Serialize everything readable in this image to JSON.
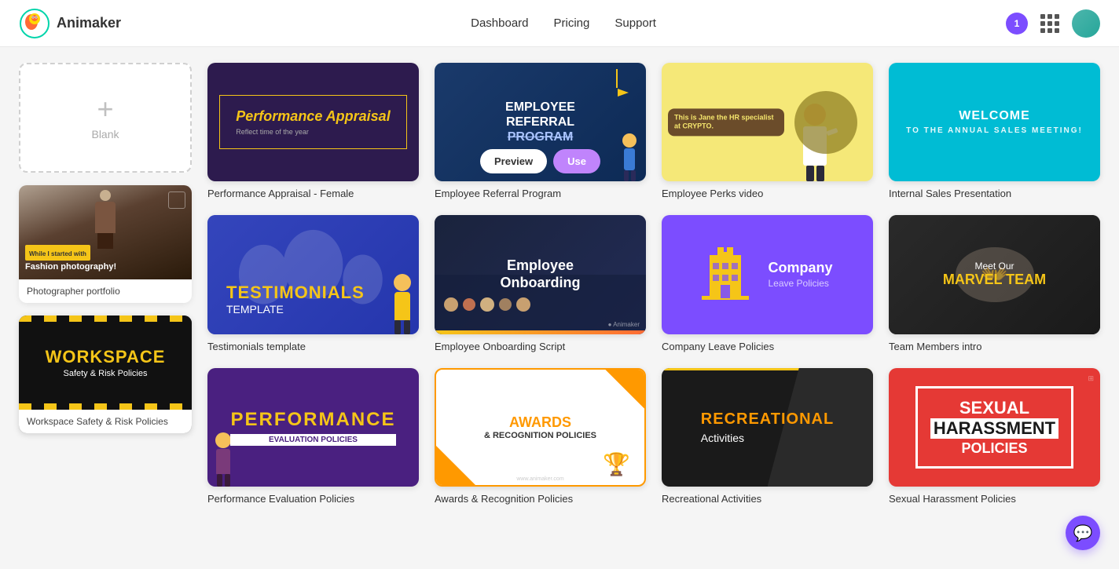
{
  "header": {
    "logo_text": "Animaker",
    "nav": {
      "dashboard": "Dashboard",
      "pricing": "Pricing",
      "support": "Support"
    },
    "notification_count": "1"
  },
  "sidebar": {
    "blank_label": "Blank",
    "items": [
      {
        "id": "photographer-portfolio",
        "label": "Photographer portfolio",
        "thumb_text": "Fashion photography!",
        "thumb_tag": "While I started with"
      },
      {
        "id": "workspace-safety",
        "label": "Workspace Safety & Risk Policies",
        "title": "WORKSPACE",
        "subtitle": "Safety & Risk Policies"
      }
    ]
  },
  "templates": [
    {
      "id": "perf-appraisal",
      "name": "Performance Appraisal - Female",
      "bg": "#2d1b4e",
      "type": "perf-appraisal"
    },
    {
      "id": "employee-referral",
      "name": "Employee Referral Program",
      "bg": "#1a3a6b",
      "type": "employee-referral",
      "lines": [
        "EMPLOYEE",
        "REFERRAL",
        "PROGRAM"
      ]
    },
    {
      "id": "employee-perks",
      "name": "Employee Perks video",
      "bg": "#f5e66d",
      "type": "employee-perks",
      "caption": "This is Jane the HR specialist at CRYPTO."
    },
    {
      "id": "internal-sales",
      "name": "Internal Sales Presentation",
      "bg": "#00bcd4",
      "type": "internal-sales",
      "title": "WELCOME",
      "subtitle": "TO THE ANNUAL SALES MEETING!"
    },
    {
      "id": "testimonials",
      "name": "Testimonials template",
      "bg": "#3d4fc4",
      "type": "testimonials",
      "title": "TESTIMONIALS",
      "subtitle": "TEMPLATE"
    },
    {
      "id": "employee-onboarding",
      "name": "Employee Onboarding Script",
      "bg": "#1a1a2e",
      "type": "employee-onboarding",
      "text": "Employee Onboarding"
    },
    {
      "id": "company-leave",
      "name": "Company Leave Policies",
      "bg": "#7c4dff",
      "type": "company-leave",
      "title": "Company",
      "subtitle": "Leave Policies"
    },
    {
      "id": "team-members",
      "name": "Team Members intro",
      "bg": "#1a1a1a",
      "type": "team-members",
      "intro": "Meet Our",
      "title": "MARVEL TEAM"
    },
    {
      "id": "perf-eval",
      "name": "Performance Evaluation Policies",
      "bg": "#4a2080",
      "type": "perf-eval",
      "title": "PERFORMANCE",
      "subtitle": "EVALUATION POLICIES"
    },
    {
      "id": "awards",
      "name": "Awards & Recognition Policies",
      "bg": "#ffffff",
      "type": "awards",
      "title": "AWARDS",
      "subtitle": "& RECOGNITION POLICIES"
    },
    {
      "id": "recreational",
      "name": "Recreational Activities",
      "bg": "#1a1a1a",
      "type": "recreational",
      "title": "RECREATIONAL",
      "subtitle": "Activities"
    },
    {
      "id": "sexual-harassment",
      "name": "Sexual Harassment Policies",
      "bg": "#e53935",
      "type": "sexual-harassment",
      "sexual": "SEXUAL",
      "harassment": "HARASSMENT",
      "policies": "POLICIES"
    }
  ],
  "buttons": {
    "preview": "Preview",
    "use": "Use"
  },
  "chat_tooltip": "chat"
}
